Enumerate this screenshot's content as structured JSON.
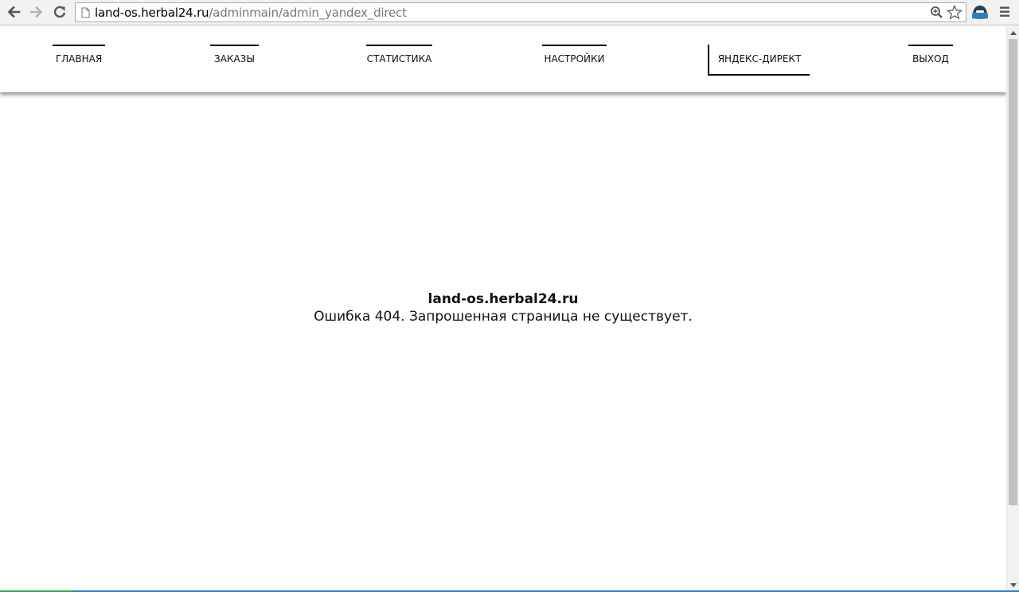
{
  "browser": {
    "url_host": "land-os.herbal24.ru",
    "url_path": "/adminmain/admin_yandex_direct",
    "back_icon": "back-arrow-icon",
    "forward_icon": "forward-arrow-icon",
    "reload_icon": "reload-icon",
    "menu_icon": "hamburger-menu-icon"
  },
  "nav": {
    "items": [
      {
        "label": "ГЛАВНАЯ",
        "active": false
      },
      {
        "label": "ЗАКАЗЫ",
        "active": false
      },
      {
        "label": "СТАТИСТИКА",
        "active": false
      },
      {
        "label": "НАСТРОЙКИ",
        "active": false
      },
      {
        "label": "ЯНДЕКС-ДИРЕКТ",
        "active": true
      },
      {
        "label": "ВЫХОД",
        "active": false
      }
    ]
  },
  "error": {
    "host": "land-os.herbal24.ru",
    "message": "Ошибка 404. Запрошенная страница не существует."
  },
  "colors": {
    "progress_blue": "#2a7ad6",
    "progress_green": "#37a84a"
  }
}
